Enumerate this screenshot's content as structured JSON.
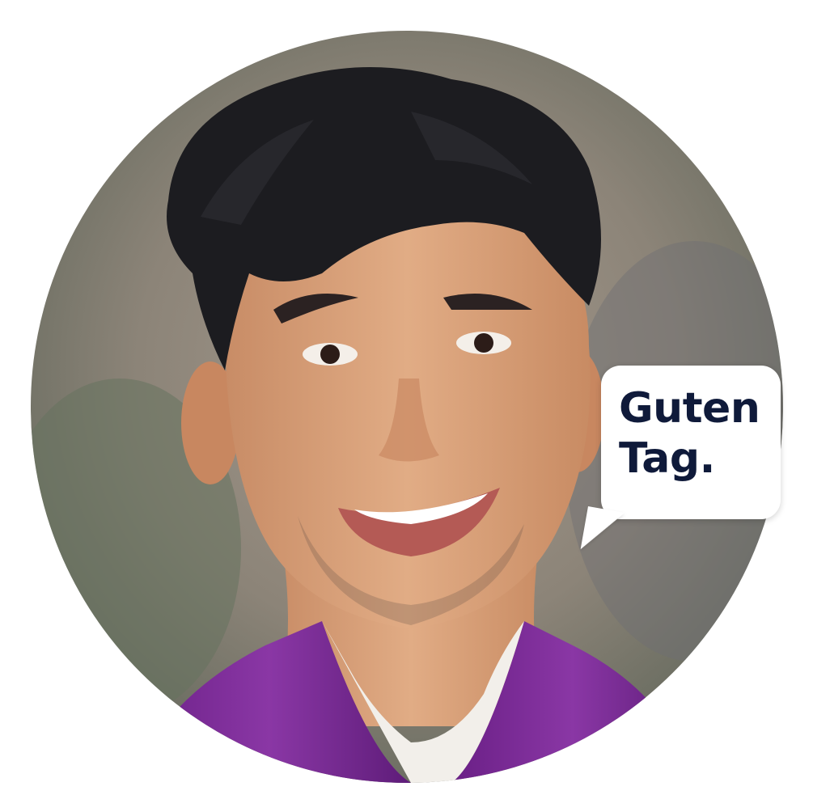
{
  "speech_bubble": {
    "line1": "Guten",
    "line2": "Tag."
  },
  "colors": {
    "background": "#ffffff",
    "shirt": "#7a2a93",
    "skin": "#d9a07a",
    "hair": "#1c1c20",
    "bubble_text": "#0f1a3a"
  },
  "icons": {
    "avatar": "smiling-man-portrait"
  }
}
